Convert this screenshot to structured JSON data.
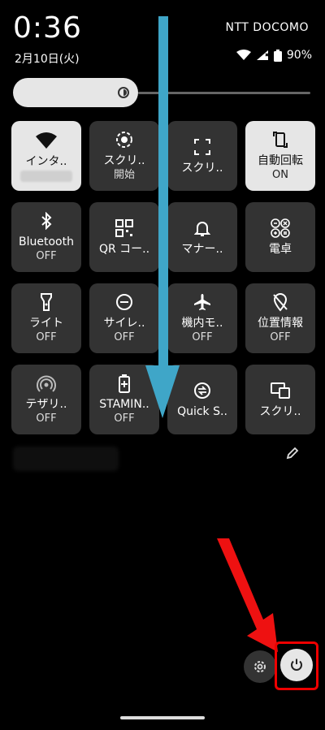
{
  "status": {
    "time": "0:36",
    "date": "2月10日(火)",
    "carrier": "NTT DOCOMO",
    "battery": "90%"
  },
  "brightness": {
    "level": 0.35
  },
  "tiles": [
    {
      "label": "インタ..",
      "sub": "",
      "icon": "wifi-icon",
      "active": true
    },
    {
      "label": "スクリ..",
      "sub": "開始",
      "icon": "screen-record-icon",
      "active": false
    },
    {
      "label": "スクリ..",
      "sub": "",
      "icon": "screenshot-icon",
      "active": false
    },
    {
      "label": "自動回転",
      "sub": "ON",
      "icon": "auto-rotate-icon",
      "active": true
    },
    {
      "label": "Bluetooth",
      "sub": "OFF",
      "icon": "bluetooth-icon",
      "active": false
    },
    {
      "label": "QR コー..",
      "sub": "",
      "icon": "qr-code-icon",
      "active": false
    },
    {
      "label": "マナー..",
      "sub": "",
      "icon": "bell-icon",
      "active": false
    },
    {
      "label": "電卓",
      "sub": "",
      "icon": "calculator-icon",
      "active": false
    },
    {
      "label": "ライト",
      "sub": "OFF",
      "icon": "flashlight-icon",
      "active": false
    },
    {
      "label": "サイレ..",
      "sub": "OFF",
      "icon": "do-not-disturb-icon",
      "active": false
    },
    {
      "label": "機内モ..",
      "sub": "OFF",
      "icon": "airplane-icon",
      "active": false
    },
    {
      "label": "位置情報",
      "sub": "OFF",
      "icon": "location-off-icon",
      "active": false
    },
    {
      "label": "テザリ..",
      "sub": "OFF",
      "icon": "hotspot-icon",
      "active": false
    },
    {
      "label": "STAMIN..",
      "sub": "OFF",
      "icon": "battery-saver-icon",
      "active": false
    },
    {
      "label": "Quick S..",
      "sub": "",
      "icon": "quick-share-icon",
      "active": false
    },
    {
      "label": "スクリ..",
      "sub": "",
      "icon": "screen-cast-icon",
      "active": false
    }
  ],
  "colors": {
    "arrow_blue": "#3fa6c8",
    "arrow_red": "#ee1111",
    "tile_bg": "#333333",
    "tile_active": "#e6e6e6"
  }
}
